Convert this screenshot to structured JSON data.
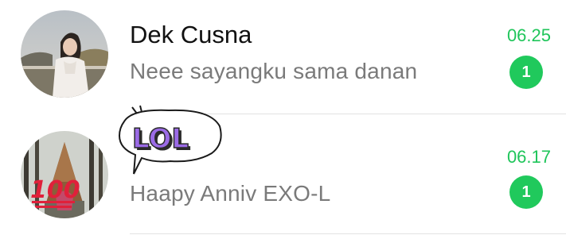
{
  "chats": [
    {
      "name": "Dek Cusna",
      "message": "Neee sayangku sama danan",
      "time": "06.25",
      "unread": "1",
      "avatar": "profile-photo"
    },
    {
      "name": "",
      "message": "Haapy Anniv EXO-L",
      "time": "06.17",
      "unread": "1",
      "avatar": "profile-photo-forest-100-emoji",
      "sticker_text": "LOL"
    }
  ],
  "colors": {
    "accent": "#1fc55a",
    "badge": "#20c95c",
    "name": "#111111",
    "message": "#7a7a7a",
    "divider": "#e2e2e2",
    "sticker_letters": "#9b6be6"
  }
}
